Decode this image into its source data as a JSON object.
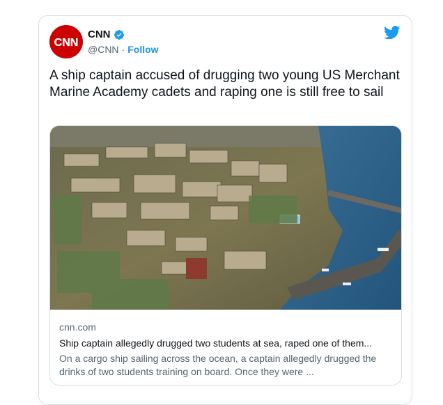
{
  "tweet": {
    "author": {
      "name": "CNN",
      "handle": "@CNN",
      "separator": "·",
      "follow_label": "Follow",
      "avatar_text": "CNN"
    },
    "text": "A ship captain accused of drugging two young US Merchant Marine Academy cadets and raping one is still free to sail",
    "card": {
      "domain": "cnn.com",
      "title": "Ship captain allegedly drugged two students at sea, raped one of them...",
      "description": "On a cargo ship sailing across the ocean, a captain allegedly drugged the drinks of two students training on board. Once they were ...",
      "image_alt": "Aerial view of a waterfront academy campus with buildings and docks"
    }
  },
  "colors": {
    "brand_red": "#cc0000",
    "twitter_blue": "#1d9bf0",
    "follow_blue": "#1b95e0"
  },
  "icons": {
    "verified": "verified-badge-icon",
    "logo": "twitter-bird-icon"
  }
}
